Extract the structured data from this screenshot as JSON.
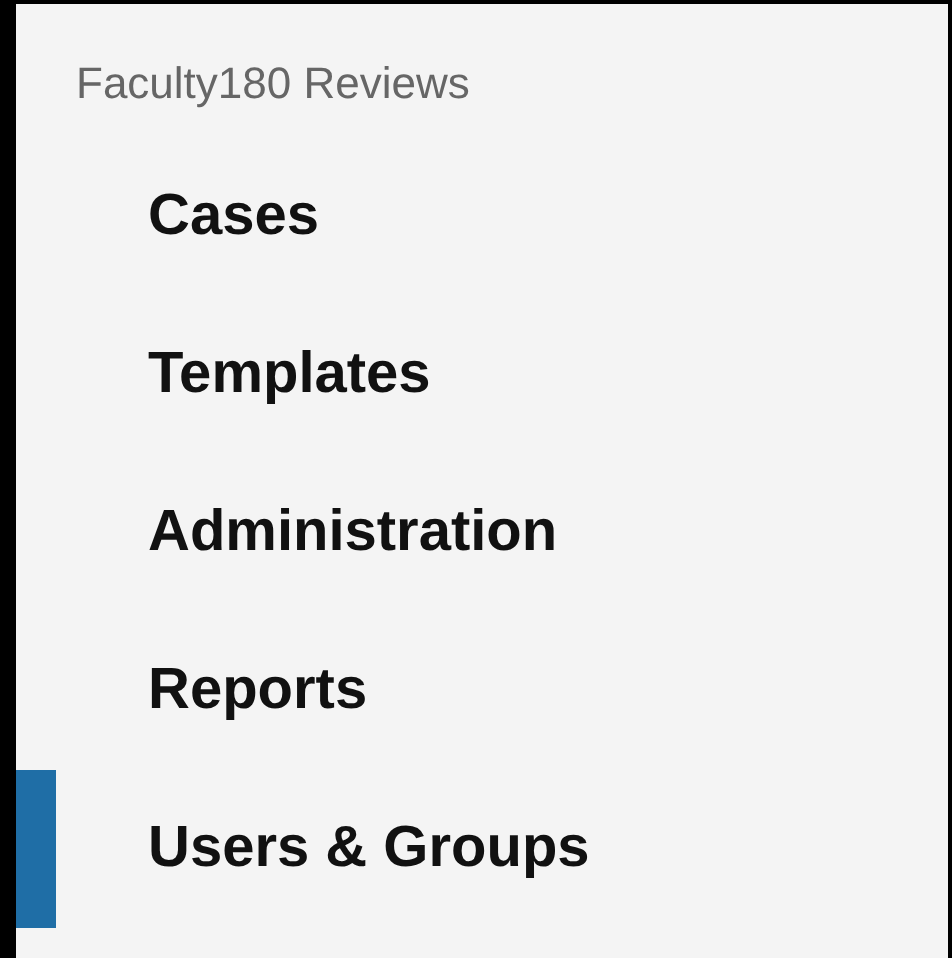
{
  "sidebar": {
    "title": "Faculty180 Reviews",
    "items": [
      {
        "label": "Cases",
        "selected": false
      },
      {
        "label": "Templates",
        "selected": false
      },
      {
        "label": "Administration",
        "selected": false
      },
      {
        "label": "Reports",
        "selected": false
      },
      {
        "label": "Users & Groups",
        "selected": true
      }
    ]
  }
}
